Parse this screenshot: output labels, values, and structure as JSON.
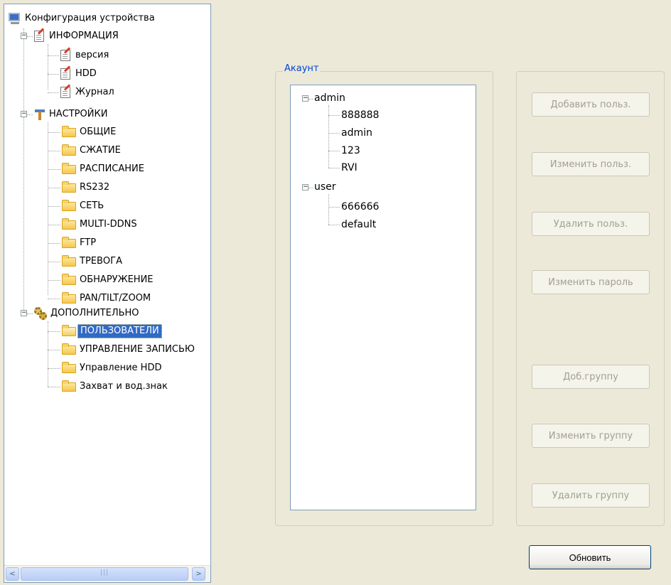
{
  "device_tree": {
    "root": "Конфигурация устройства",
    "groups": [
      {
        "label": "ИНФОРМАЦИЯ",
        "icon": "edit-document-icon",
        "items": [
          "версия",
          "HDD",
          "Журнал"
        ]
      },
      {
        "label": "НАСТРОЙКИ",
        "icon": "tools-icon",
        "items": [
          "ОБЩИЕ",
          "СЖАТИЕ",
          "РАСПИСАНИЕ",
          "RS232",
          "СЕТЬ",
          "MULTI-DDNS",
          "FTP",
          "ТРЕВОГА",
          "ОБНАРУЖЕНИЕ",
          "PAN/TILT/ZOOM"
        ]
      },
      {
        "label": "ДОПОЛНИТЕЛЬНО",
        "icon": "gears-icon",
        "items": [
          "ПОЛЬЗОВАТЕЛИ",
          "УПРАВЛЕНИЕ ЗАПИСЬЮ",
          "Управление HDD",
          "Захват и вод.знак"
        ]
      }
    ],
    "selected": "ПОЛЬЗОВАТЕЛИ",
    "scrollbar": {
      "left_arrow": "<",
      "right_arrow": ">",
      "thumb_grip": "|||"
    }
  },
  "account": {
    "legend": "Акаунт",
    "groups": [
      {
        "name": "admin",
        "members": [
          "888888",
          "admin",
          "123",
          "RVI"
        ]
      },
      {
        "name": "user",
        "members": [
          "666666",
          "default"
        ]
      }
    ]
  },
  "buttons": {
    "add_user": "Добавить польз.",
    "edit_user": "Изменить польз.",
    "delete_user": "Удалить польз.",
    "change_password": "Изменить пароль",
    "add_group": "Доб.группу",
    "edit_group": "Изменить группу",
    "delete_group": "Удалить группу",
    "refresh": "Обновить"
  },
  "colors": {
    "window_bg": "#ece9d8",
    "selection": "#316ac5",
    "legend_text": "#0046d5",
    "disabled_text": "#a19f94"
  }
}
